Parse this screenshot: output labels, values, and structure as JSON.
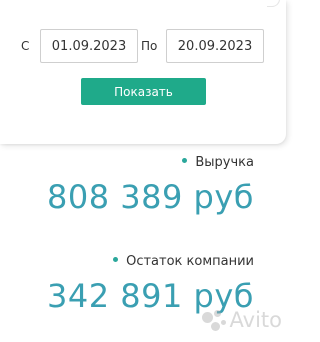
{
  "filter": {
    "from_label": "С",
    "from_value": "01.09.2023",
    "to_label": "По",
    "to_value": "20.09.2023",
    "show_button": "Показать"
  },
  "metrics": [
    {
      "label": "Выручка",
      "value": "808 389 руб"
    },
    {
      "label": "Остаток компании",
      "value": "342 891 руб"
    }
  ],
  "watermark": "Avito",
  "colors": {
    "accent_button": "#1faa8a",
    "value_text": "#3a9fb2",
    "bullet": "#2aa79b"
  }
}
